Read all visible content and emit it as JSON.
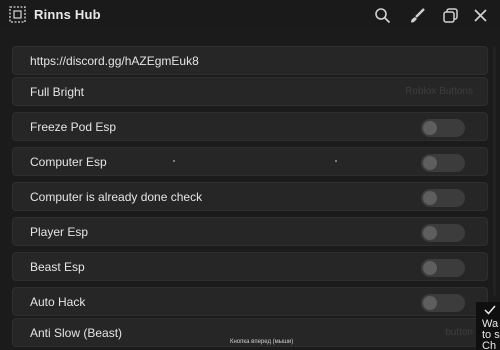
{
  "window": {
    "title": "Rinns Hub"
  },
  "titlebar": {
    "icons": [
      "search-icon",
      "brush-icon",
      "minimize-icon",
      "close-icon"
    ]
  },
  "items": {
    "discord": {
      "label": "https://discord.gg/hAZEgmEuk8"
    },
    "full_bright": {
      "label": "Full Bright",
      "hint": "Roblox Buttons"
    },
    "freeze_pod_esp": {
      "label": "Freeze Pod Esp",
      "on": false
    },
    "computer_esp": {
      "label": "Computer Esp",
      "on": false
    },
    "computer_done_check": {
      "label": "Computer is already done check",
      "on": false
    },
    "player_esp": {
      "label": "Player Esp",
      "on": false
    },
    "beast_esp": {
      "label": "Beast Esp",
      "on": false
    },
    "auto_hack": {
      "label": "Auto Hack",
      "on": false
    },
    "anti_slow": {
      "label": "Anti Slow (Beast)",
      "hint": "button"
    }
  },
  "notification": {
    "line1": "Wa",
    "line2": "to s",
    "line3": "Ch"
  },
  "caption": {
    "text": "Кнопка вперед (мыши)"
  },
  "colors": {
    "background": "#1b1b1b",
    "row": "#262626",
    "toggle_off": "#3c3c3c"
  }
}
